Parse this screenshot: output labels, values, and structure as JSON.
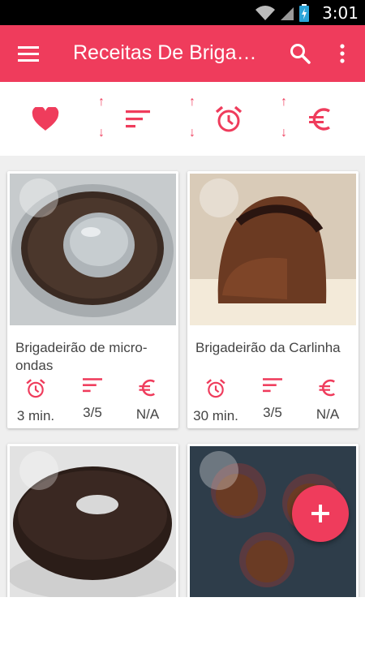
{
  "status_bar": {
    "time": "3:01"
  },
  "app_bar": {
    "title": "Receitas De Brigadeiro"
  },
  "colors": {
    "accent": "#ef3c5c",
    "background": "#efefef"
  },
  "filter_bar": {
    "items": [
      {
        "icon": "heart-icon"
      },
      {
        "icon": "sort-difficulty-icon",
        "arrows": [
          "↑",
          "↓"
        ]
      },
      {
        "icon": "alarm-clock-icon",
        "arrows": [
          "↑",
          "↓"
        ]
      },
      {
        "icon": "euro-icon",
        "arrows": [
          "↑",
          "↓"
        ]
      }
    ]
  },
  "recipes": [
    {
      "name": "Brigadeirão de micro-ondas",
      "time": "3 min.",
      "difficulty": "3/5",
      "cost": "N/A"
    },
    {
      "name": "Brigadeirão da Carlinha",
      "time": "30 min.",
      "difficulty": "3/5",
      "cost": "N/A"
    },
    {
      "name": "",
      "time": "",
      "difficulty": "",
      "cost": ""
    },
    {
      "name": "",
      "time": "",
      "difficulty": "",
      "cost": ""
    }
  ],
  "fab": {
    "label": "+"
  }
}
